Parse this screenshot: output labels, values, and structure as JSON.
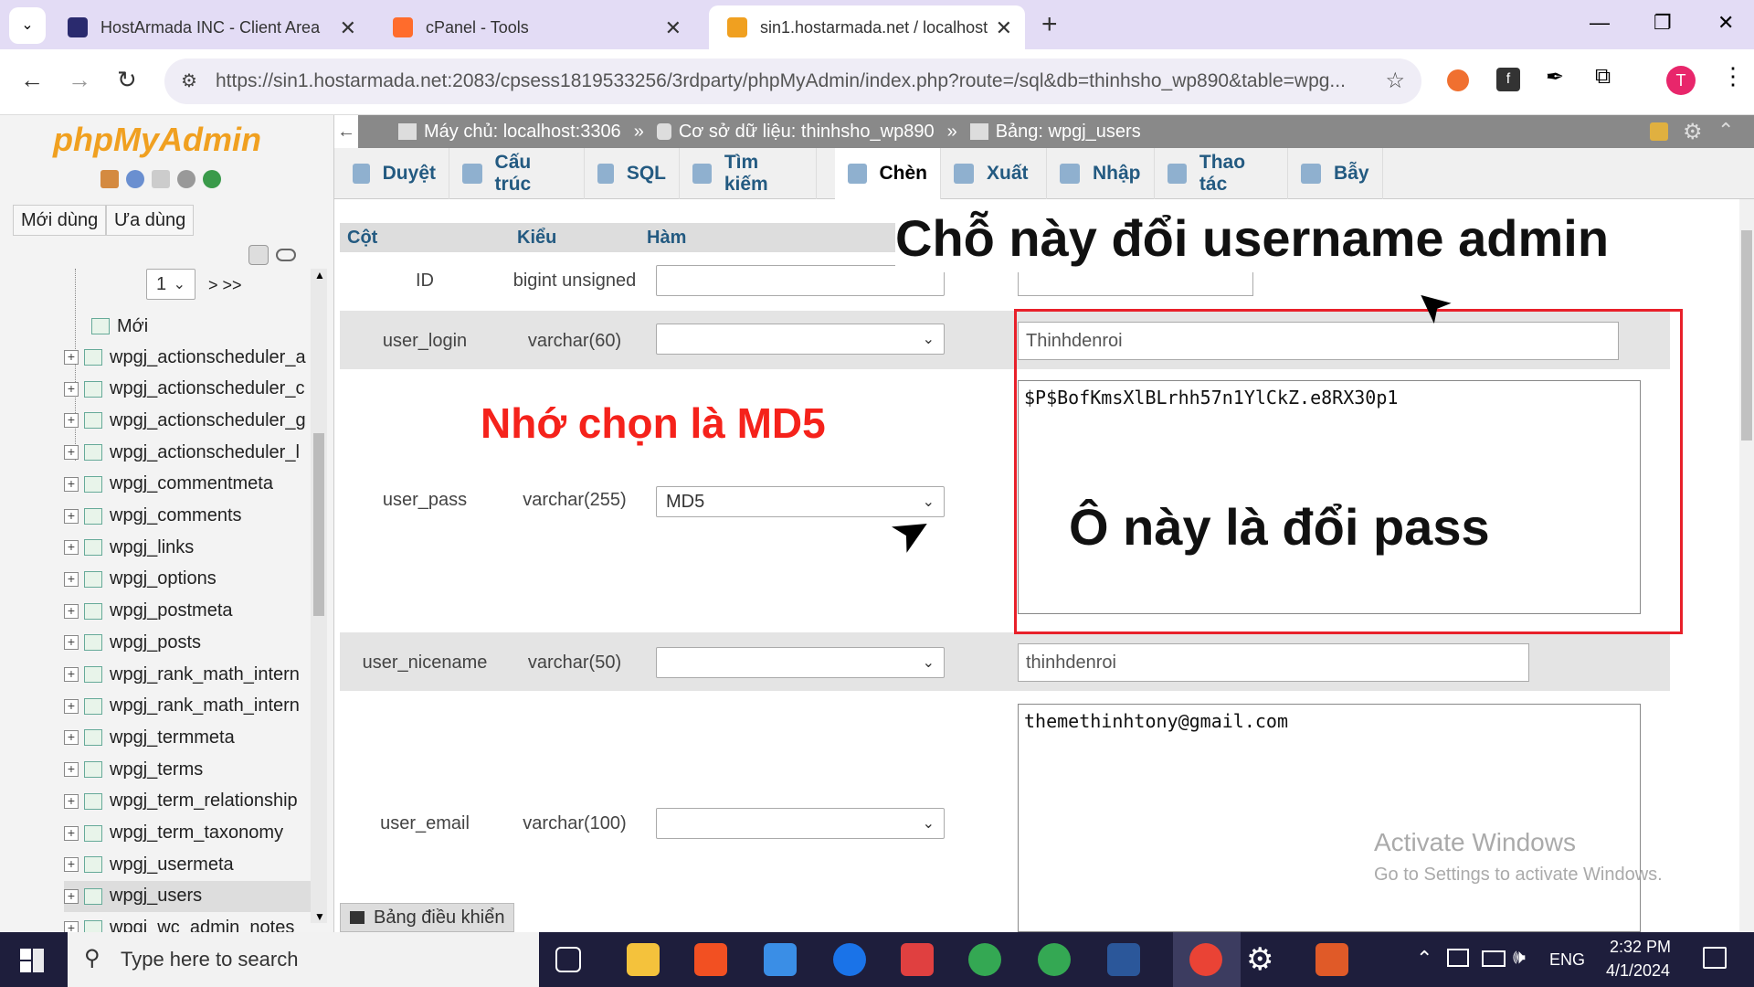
{
  "browser": {
    "tabs": [
      {
        "title": "HostArmada INC - Client Area",
        "active": false,
        "icon_color": "#2a2a6e"
      },
      {
        "title": "cPanel - Tools",
        "active": false,
        "icon_color": "#ff6c2c"
      },
      {
        "title": "sin1.hostarmada.net / localhost",
        "active": true,
        "icon_color": "#f0a020"
      }
    ],
    "new_tab": "+",
    "url": "https://sin1.hostarmada.net:2083/cpsess1819533256/3rdparty/phpMyAdmin/index.php?route=/sql&db=thinhsho_wp890&table=wpg...",
    "profile_initial": "T",
    "window_controls": {
      "minimize": "—",
      "restore": "❐",
      "close": "✕"
    }
  },
  "sidebar": {
    "logo": "phpMyAdmin",
    "buttons": [
      "Mới dùng",
      "Ưa dùng"
    ],
    "page_select": "1",
    "next_label": "> >>",
    "new_label": "Mới",
    "tables": [
      "wpgj_actionscheduler_a",
      "wpgj_actionscheduler_c",
      "wpgj_actionscheduler_g",
      "wpgj_actionscheduler_l",
      "wpgj_commentmeta",
      "wpgj_comments",
      "wpgj_links",
      "wpgj_options",
      "wpgj_postmeta",
      "wpgj_posts",
      "wpgj_rank_math_intern",
      "wpgj_rank_math_intern",
      "wpgj_termmeta",
      "wpgj_terms",
      "wpgj_term_relationship",
      "wpgj_term_taxonomy",
      "wpgj_usermeta",
      "wpgj_users",
      "wpgj_wc_admin_notes"
    ]
  },
  "breadcrumb": {
    "server": "Máy chủ: localhost:3306",
    "database": "Cơ sở dữ liệu: thinhsho_wp890",
    "table": "Bảng: wpgj_users",
    "separator": "»"
  },
  "tabs": [
    "Duyệt",
    "Cấu trúc",
    "SQL",
    "Tìm kiếm",
    "Chèn",
    "Xuất",
    "Nhập",
    "Thao tác",
    "Bẫy"
  ],
  "active_tab": "Chèn",
  "columns_header": {
    "col": "Cột",
    "type": "Kiểu",
    "func": "Hàm"
  },
  "rows": [
    {
      "name": "ID",
      "type": "bigint unsigned",
      "func": "",
      "value": ""
    },
    {
      "name": "user_login",
      "type": "varchar(60)",
      "func": "",
      "value": "Thinhdenroi"
    },
    {
      "name": "user_pass",
      "type": "varchar(255)",
      "func": "MD5",
      "value": "$P$BofKmsXlBLrhh57n1YlCkZ.e8RX30p1"
    },
    {
      "name": "user_nicename",
      "type": "varchar(50)",
      "func": "",
      "value": "thinhdenroi"
    },
    {
      "name": "user_email",
      "type": "varchar(100)",
      "func": "",
      "value": "themethinhtony@gmail.com"
    }
  ],
  "console_label": "Bảng điều khiển",
  "annotations": {
    "username": "Chỗ này đổi username admin",
    "md5": "Nhớ chọn là MD5",
    "password": "Ô này là đổi pass"
  },
  "watermark": {
    "line1": "Activate Windows",
    "line2": "Go to Settings to activate Windows."
  },
  "taskbar": {
    "search_placeholder": "Type here to search",
    "language": "ENG",
    "time": "2:32 PM",
    "date": "4/1/2024"
  }
}
